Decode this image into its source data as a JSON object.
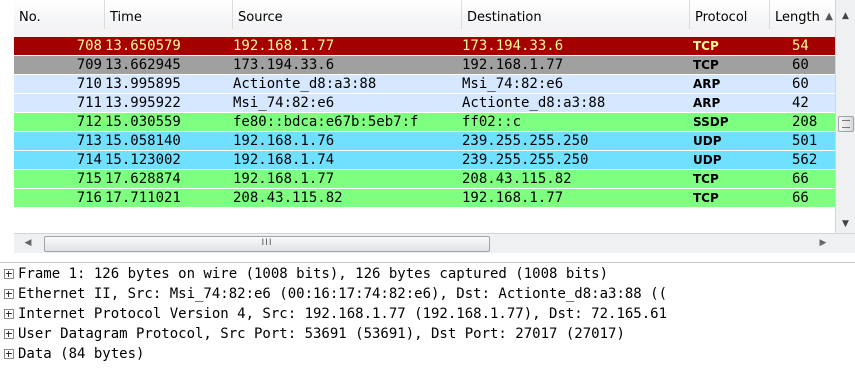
{
  "columns": [
    {
      "key": "no",
      "label": "No."
    },
    {
      "key": "time",
      "label": "Time"
    },
    {
      "key": "source",
      "label": "Source"
    },
    {
      "key": "destination",
      "label": "Destination"
    },
    {
      "key": "protocol",
      "label": "Protocol"
    },
    {
      "key": "length",
      "label": "Length"
    }
  ],
  "rows": [
    {
      "no": "708",
      "time": "13.650579",
      "source": "192.168.1.77",
      "destination": "173.194.33.6",
      "protocol": "TCP",
      "length": "54",
      "bg": "#a40000",
      "fg": "#fffc9c",
      "selected": false
    },
    {
      "no": "709",
      "time": "13.662945",
      "source": "173.194.33.6",
      "destination": "192.168.1.77",
      "protocol": "TCP",
      "length": "60",
      "bg": "#a0a0a0",
      "fg": "#000000",
      "selected": false
    },
    {
      "no": "710",
      "time": "13.995895",
      "source": "Actionte_d8:a3:88",
      "destination": "Msi_74:82:e6",
      "protocol": "ARP",
      "length": "60",
      "bg": "#d6e8ff",
      "fg": "#000000",
      "selected": false
    },
    {
      "no": "711",
      "time": "13.995922",
      "source": "Msi_74:82:e6",
      "destination": "Actionte_d8:a3:88",
      "protocol": "ARP",
      "length": "42",
      "bg": "#d6e8ff",
      "fg": "#000000",
      "selected": false
    },
    {
      "no": "712",
      "time": "15.030559",
      "source": "fe80::bdca:e67b:5eb7:f",
      "destination": "ff02::c",
      "protocol": "SSDP",
      "length": "208",
      "bg": "#7fff7f",
      "fg": "#000000",
      "selected": false
    },
    {
      "no": "713",
      "time": "15.058140",
      "source": "192.168.1.76",
      "destination": "239.255.255.250",
      "protocol": "UDP",
      "length": "501",
      "bg": "#70e0ff",
      "fg": "#000000",
      "selected": false
    },
    {
      "no": "714",
      "time": "15.123002",
      "source": "192.168.1.74",
      "destination": "239.255.255.250",
      "protocol": "UDP",
      "length": "562",
      "bg": "#70e0ff",
      "fg": "#000000",
      "selected": false
    },
    {
      "no": "715",
      "time": "17.628874",
      "source": "192.168.1.77",
      "destination": "208.43.115.82",
      "protocol": "TCP",
      "length": "66",
      "bg": "#7fff7f",
      "fg": "#000000",
      "selected": false
    },
    {
      "no": "716",
      "time": "17.711021",
      "source": "208.43.115.82",
      "destination": "192.168.1.77",
      "protocol": "TCP",
      "length": "66",
      "bg": "#7fff7f",
      "fg": "#000000",
      "selected": false
    }
  ],
  "scroll": {
    "up_icon": "▲",
    "down_icon": "▼",
    "left_icon": "◀",
    "right_icon": "▶",
    "hthumb_grip": "III"
  },
  "details": [
    {
      "expander": "plus-box-icon",
      "text": "Frame 1: 126 bytes on wire (1008 bits), 126 bytes captured (1008 bits)"
    },
    {
      "expander": "plus-box-icon",
      "text": "Ethernet II, Src: Msi_74:82:e6 (00:16:17:74:82:e6), Dst: Actionte_d8:a3:88 (("
    },
    {
      "expander": "plus-box-icon",
      "text": "Internet Protocol Version 4, Src: 192.168.1.77 (192.168.1.77), Dst: 72.165.61"
    },
    {
      "expander": "plus-box-icon",
      "text": "User Datagram Protocol, Src Port: 53691 (53691), Dst Port: 27017 (27017)"
    },
    {
      "expander": "plus-box-icon",
      "text": "Data (84 bytes)"
    }
  ]
}
